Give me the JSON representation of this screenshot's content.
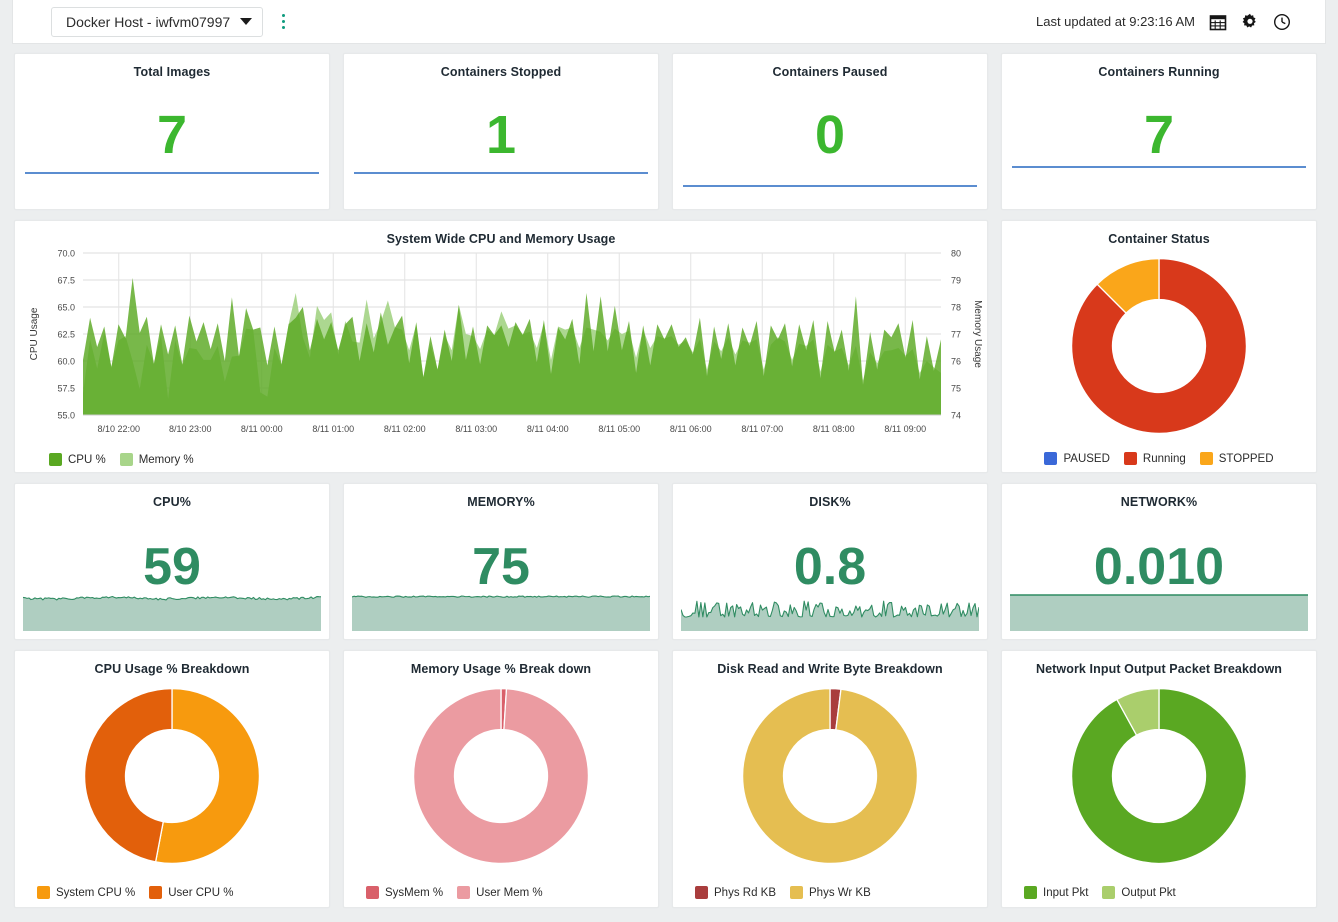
{
  "topbar": {
    "host_label": "Docker Host - iwfvm07997",
    "kebab_icon": "kebab-menu-icon",
    "last_updated": "Last updated at 9:23:16 AM",
    "calendar_icon": "calendar-icon",
    "gear_icon": "gear-icon",
    "clock_icon": "clock-icon"
  },
  "kpis": [
    {
      "title": "Total Images",
      "value": "7",
      "color": "#3cb72f",
      "bar_y": 118
    },
    {
      "title": "Containers Stopped",
      "value": "1",
      "color": "#3cb72f",
      "bar_y": 118
    },
    {
      "title": "Containers Paused",
      "value": "0",
      "color": "#3cb72f",
      "bar_y": 130
    },
    {
      "title": "Containers Running",
      "value": "7",
      "color": "#3cb72f",
      "bar_y": 112
    }
  ],
  "metrics": [
    {
      "title": "CPU%",
      "value": "59",
      "color": "#2f8c62",
      "spark": "noisy-flat-high"
    },
    {
      "title": "MEMORY%",
      "value": "75",
      "color": "#2f8c62",
      "spark": "flat-high"
    },
    {
      "title": "DISK%",
      "value": "0.8",
      "color": "#2f8c62",
      "spark": "noisy-low"
    },
    {
      "title": "NETWORK%",
      "value": "0.010",
      "color": "#2f8c62",
      "spark": "solid-block"
    }
  ],
  "chart_data": [
    {
      "id": "system-wide-cpu-memory",
      "type": "area",
      "title": "System Wide CPU and Memory Usage",
      "xlabel": "",
      "ylabel": "CPU Usage",
      "y2label": "Memory Usage",
      "ylim": [
        55.0,
        70.0
      ],
      "y2lim": [
        74,
        80
      ],
      "yticks": [
        "55.0",
        "57.5",
        "60.0",
        "62.5",
        "65.0",
        "67.5",
        "70.0"
      ],
      "y2ticks": [
        "74",
        "75",
        "76",
        "77",
        "78",
        "79",
        "80"
      ],
      "xticks": [
        "8/10 22:00",
        "8/10 23:00",
        "8/11 00:00",
        "8/11 01:00",
        "8/11 02:00",
        "8/11 03:00",
        "8/11 04:00",
        "8/11 05:00",
        "8/11 06:00",
        "8/11 07:00",
        "8/11 08:00",
        "8/11 09:00"
      ],
      "grid": true,
      "legend_position": "bottom-left",
      "series": [
        {
          "name": "CPU %",
          "color": "#5aa822",
          "values": [
            60.1,
            64.0,
            61.3,
            63.2,
            59.4,
            63.4,
            62.1,
            67.7,
            62.6,
            64.1,
            59.7,
            63.4,
            60.6,
            63.3,
            59.7,
            64.2,
            61.8,
            63.6,
            61.1,
            63.5,
            60.0,
            65.9,
            60.4,
            64.9,
            62.9,
            63.1,
            59.6,
            63.2,
            59.7,
            63.4,
            64.0,
            65.0,
            61.0,
            63.9,
            62.0,
            63.6,
            61.0,
            63.4,
            64.1,
            60.0,
            63.5,
            60.8,
            64.5,
            61.5,
            63.1,
            64.2,
            59.8,
            63.6,
            58.5,
            62.3,
            59.2,
            62.9,
            60.0,
            65.2,
            60.1,
            63.2,
            59.7,
            63.3,
            62.4,
            63.3,
            61.3,
            63.6,
            62.4,
            63.9,
            59.9,
            63.8,
            58.8,
            63.1,
            62.0,
            63.9,
            59.7,
            66.3,
            60.9,
            66.0,
            60.9,
            65.1,
            61.0,
            63.7,
            58.9,
            63.3,
            59.6,
            63.4,
            62.0,
            63.4,
            61.3,
            62.2,
            60.6,
            64.0,
            58.6,
            63.2,
            60.2,
            63.5,
            59.6,
            63.1,
            61.4,
            63.7,
            58.6,
            63.3,
            62.0,
            63.5,
            59.5,
            63.4,
            61.0,
            63.8,
            58.4,
            63.7,
            60.8,
            62.9,
            59.1,
            66.0,
            57.8,
            62.7,
            59.2,
            62.9,
            62.2,
            63.5,
            60.3,
            63.8,
            58.3,
            62.3,
            59.1,
            62.0
          ]
        },
        {
          "name": "Memory %",
          "color": "#a8d58a",
          "values": [
            57.0,
            62.0,
            59.3,
            62.6,
            59.5,
            61.9,
            62.3,
            60.0,
            57.4,
            61.5,
            59.8,
            62.4,
            56.5,
            61.9,
            59.6,
            61.2,
            61.1,
            60.1,
            60.1,
            61.4,
            58.1,
            60.4,
            60.5,
            63.0,
            62.9,
            57.1,
            56.7,
            61.2,
            59.6,
            63.4,
            66.3,
            62.2,
            60.3,
            65.1,
            63.8,
            64.5,
            60.6,
            63.7,
            61.8,
            61.7,
            65.7,
            62.1,
            63.6,
            65.6,
            63.1,
            62.9,
            61.0,
            63.4,
            58.5,
            61.5,
            59.2,
            62.4,
            61.0,
            65.2,
            62.5,
            62.3,
            61.1,
            62.9,
            62.4,
            64.6,
            63.0,
            63.3,
            62.5,
            62.7,
            61.2,
            63.5,
            60.1,
            63.2,
            62.9,
            63.1,
            61.2,
            63.1,
            62.9,
            62.7,
            61.9,
            63.0,
            62.5,
            62.8,
            60.3,
            62.9,
            61.2,
            62.3,
            62.1,
            62.3,
            61.5,
            61.9,
            60.8,
            62.0,
            59.2,
            61.8,
            60.9,
            62.2,
            60.6,
            61.9,
            61.7,
            62.0,
            59.2,
            61.5,
            62.2,
            61.8,
            60.1,
            61.6,
            61.4,
            62.0,
            59.0,
            61.5,
            60.9,
            61.2,
            59.6,
            61.4,
            58.2,
            60.8,
            59.8,
            60.9,
            61.0,
            61.2,
            60.5,
            61.1,
            58.9,
            60.0,
            59.4,
            58.9
          ]
        }
      ]
    },
    {
      "id": "container-status",
      "type": "pie",
      "title": "Container Status",
      "labels": [
        "PAUSED",
        "Running",
        "STOPPED"
      ],
      "values": [
        0,
        87.5,
        12.5
      ],
      "colors": [
        "#3a68d8",
        "#d8391b",
        "#faa61a"
      ],
      "legend_position": "bottom-center",
      "donut": true
    },
    {
      "id": "cpu-usage-breakdown",
      "type": "pie",
      "title": "CPU Usage % Breakdown",
      "labels": [
        "System CPU %",
        "User CPU %"
      ],
      "values": [
        53,
        47
      ],
      "colors": [
        "#f79a0e",
        "#e2600b"
      ],
      "legend_position": "bottom-left",
      "donut": true
    },
    {
      "id": "memory-usage-breakdown",
      "type": "pie",
      "title": "Memory Usage % Break down",
      "labels": [
        "SysMem %",
        "User Mem %"
      ],
      "values": [
        1,
        99
      ],
      "colors": [
        "#d9606a",
        "#eb9ba1"
      ],
      "legend_position": "bottom-left",
      "donut": true
    },
    {
      "id": "disk-read-write-breakdown",
      "type": "pie",
      "title": "Disk Read and Write Byte Breakdown",
      "labels": [
        "Phys Rd KB",
        "Phys Wr KB"
      ],
      "values": [
        2,
        98
      ],
      "colors": [
        "#a93d3d",
        "#e5be51"
      ],
      "legend_position": "bottom-left",
      "donut": true
    },
    {
      "id": "network-packet-breakdown",
      "type": "pie",
      "title": "Network Input Output Packet Breakdown",
      "labels": [
        "Input Pkt",
        "Output Pkt"
      ],
      "values": [
        92,
        8
      ],
      "colors": [
        "#5aa822",
        "#aace6c"
      ],
      "legend_position": "bottom-left",
      "donut": true
    }
  ]
}
